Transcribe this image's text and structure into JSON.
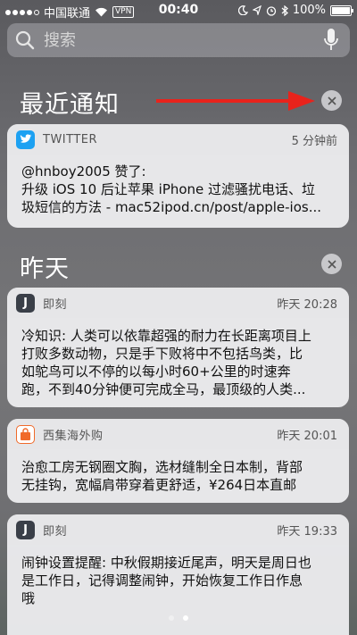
{
  "status_bar": {
    "carrier": "中国联通",
    "network": "VPN",
    "time": "00:40",
    "battery": "100%"
  },
  "search": {
    "placeholder": "搜索"
  },
  "recent": {
    "title": "最近通知",
    "notifications": [
      {
        "app": "TWITTER",
        "time": "5 分钟前",
        "icon_color": "#1da1f2",
        "lines": [
          "@hnboy2005 赞了:",
          "升级 iOS 10 后让苹果 iPhone 过滤骚扰电话、垃",
          "圾短信的方法 -  mac52ipod.cn/post/apple-ios..."
        ]
      }
    ]
  },
  "yesterday": {
    "title": "昨天",
    "notifications": [
      {
        "app": "即刻",
        "icon_letter": "J",
        "icon_color": "#3a3f48",
        "time": "昨天 20:28",
        "lines": [
          "冷知识: 人类可以依靠超强的耐力在长距离项目上",
          "打败多数动物，只是手下败将中不包括鸟类，比",
          "如鸵鸟可以不停的以每小时60+公里的时速奔",
          "跑，不到40分钟便可完成全马，最顶级的人类..."
        ]
      },
      {
        "app": "西集海外购",
        "icon_color": "#f06a2a",
        "time": "昨天 20:01",
        "lines": [
          "治愈工房无钢圈文胸，选材缝制全日本制，背部",
          "无挂钩，宽幅肩带穿着更舒适，¥264日本直邮"
        ]
      },
      {
        "app": "即刻",
        "icon_letter": "J",
        "icon_color": "#3a3f48",
        "time": "昨天 19:33",
        "lines": [
          "闹钟设置提醒: 中秋假期接近尾声，明天是周日也",
          "是工作日，记得调整闹钟，开始恢复工作日作息",
          "哦"
        ]
      }
    ]
  },
  "page_indicator": {
    "count": 2,
    "active": 2
  }
}
